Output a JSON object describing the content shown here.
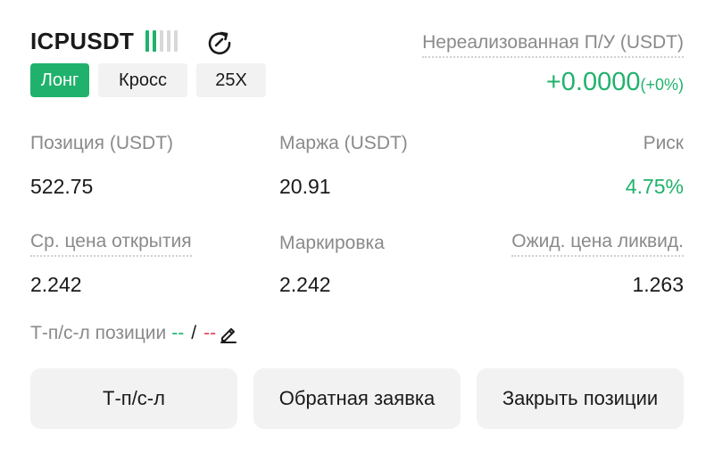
{
  "header": {
    "symbol": "ICPUSDT",
    "bar_colors": [
      "#20b26c",
      "#20b26c",
      "#d8d8d8",
      "#d8d8d8",
      "#d8d8d8"
    ],
    "tags": {
      "side": "Лонг",
      "margin_mode": "Кросс",
      "leverage": "25X"
    }
  },
  "pnl": {
    "label": "Нереализованная П/У (USDT)",
    "value": "+0.0000",
    "percent": "(+0%)"
  },
  "stats": {
    "position": {
      "label": "Позиция (USDT)",
      "value": "522.75"
    },
    "margin": {
      "label": "Маржа (USDT)",
      "value": "20.91"
    },
    "risk": {
      "label": "Риск",
      "value": "4.75%"
    },
    "entry_price": {
      "label": "Ср. цена открытия",
      "value": "2.242"
    },
    "mark_price": {
      "label": "Маркировка",
      "value": "2.242"
    },
    "liq_price": {
      "label": "Ожид. цена ликвид.",
      "value": "1.263"
    }
  },
  "tpsl": {
    "label": "Т-п/с-л позиции",
    "tp": "--",
    "separator": "/",
    "sl": "--"
  },
  "buttons": {
    "tpsl": "Т-п/с-л",
    "reverse": "Обратная заявка",
    "close": "Закрыть позиции"
  },
  "colors": {
    "accent_green": "#20b26c",
    "loss_red": "#e0405a",
    "muted_text": "#8a8a8a",
    "chip_bg": "#f2f2f2"
  }
}
